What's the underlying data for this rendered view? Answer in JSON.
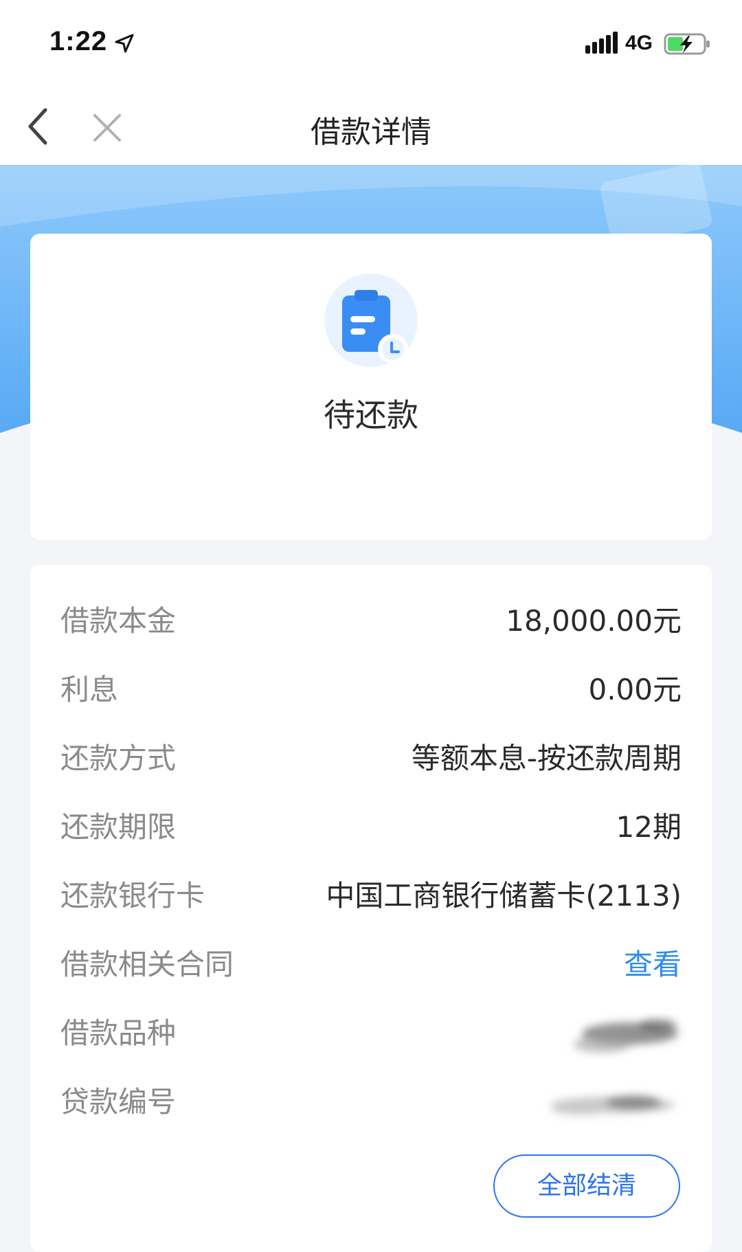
{
  "status_bar": {
    "time": "1:22",
    "network": "4G",
    "icons": [
      "location-arrow-icon",
      "signal-icon",
      "battery-charging-icon"
    ]
  },
  "nav": {
    "title": "借款详情",
    "back_icon": "chevron-left-icon",
    "close_icon": "close-icon"
  },
  "status_card": {
    "icon": "clipboard-clock-icon",
    "status": "待还款"
  },
  "details": [
    {
      "label": "借款本金",
      "value": "18,000.00元"
    },
    {
      "label": "利息",
      "value": "0.00元"
    },
    {
      "label": "还款方式",
      "value": "等额本息-按还款周期"
    },
    {
      "label": "还款期限",
      "value": "12期"
    },
    {
      "label": "还款银行卡",
      "value": "中国工商银行储蓄卡(2113)"
    },
    {
      "label": "借款相关合同",
      "value": "查看"
    },
    {
      "label": "借款品种",
      "value": ""
    },
    {
      "label": "贷款编号",
      "value": ""
    }
  ],
  "actions": {
    "settle_all": "全部结清"
  },
  "colors": {
    "accent_blue": "#2d73ee",
    "link_blue": "#2d8cf0",
    "banner_blue": "#5faef5",
    "label_gray": "#8a8a8a",
    "page_bg": "#f3f5f9"
  }
}
